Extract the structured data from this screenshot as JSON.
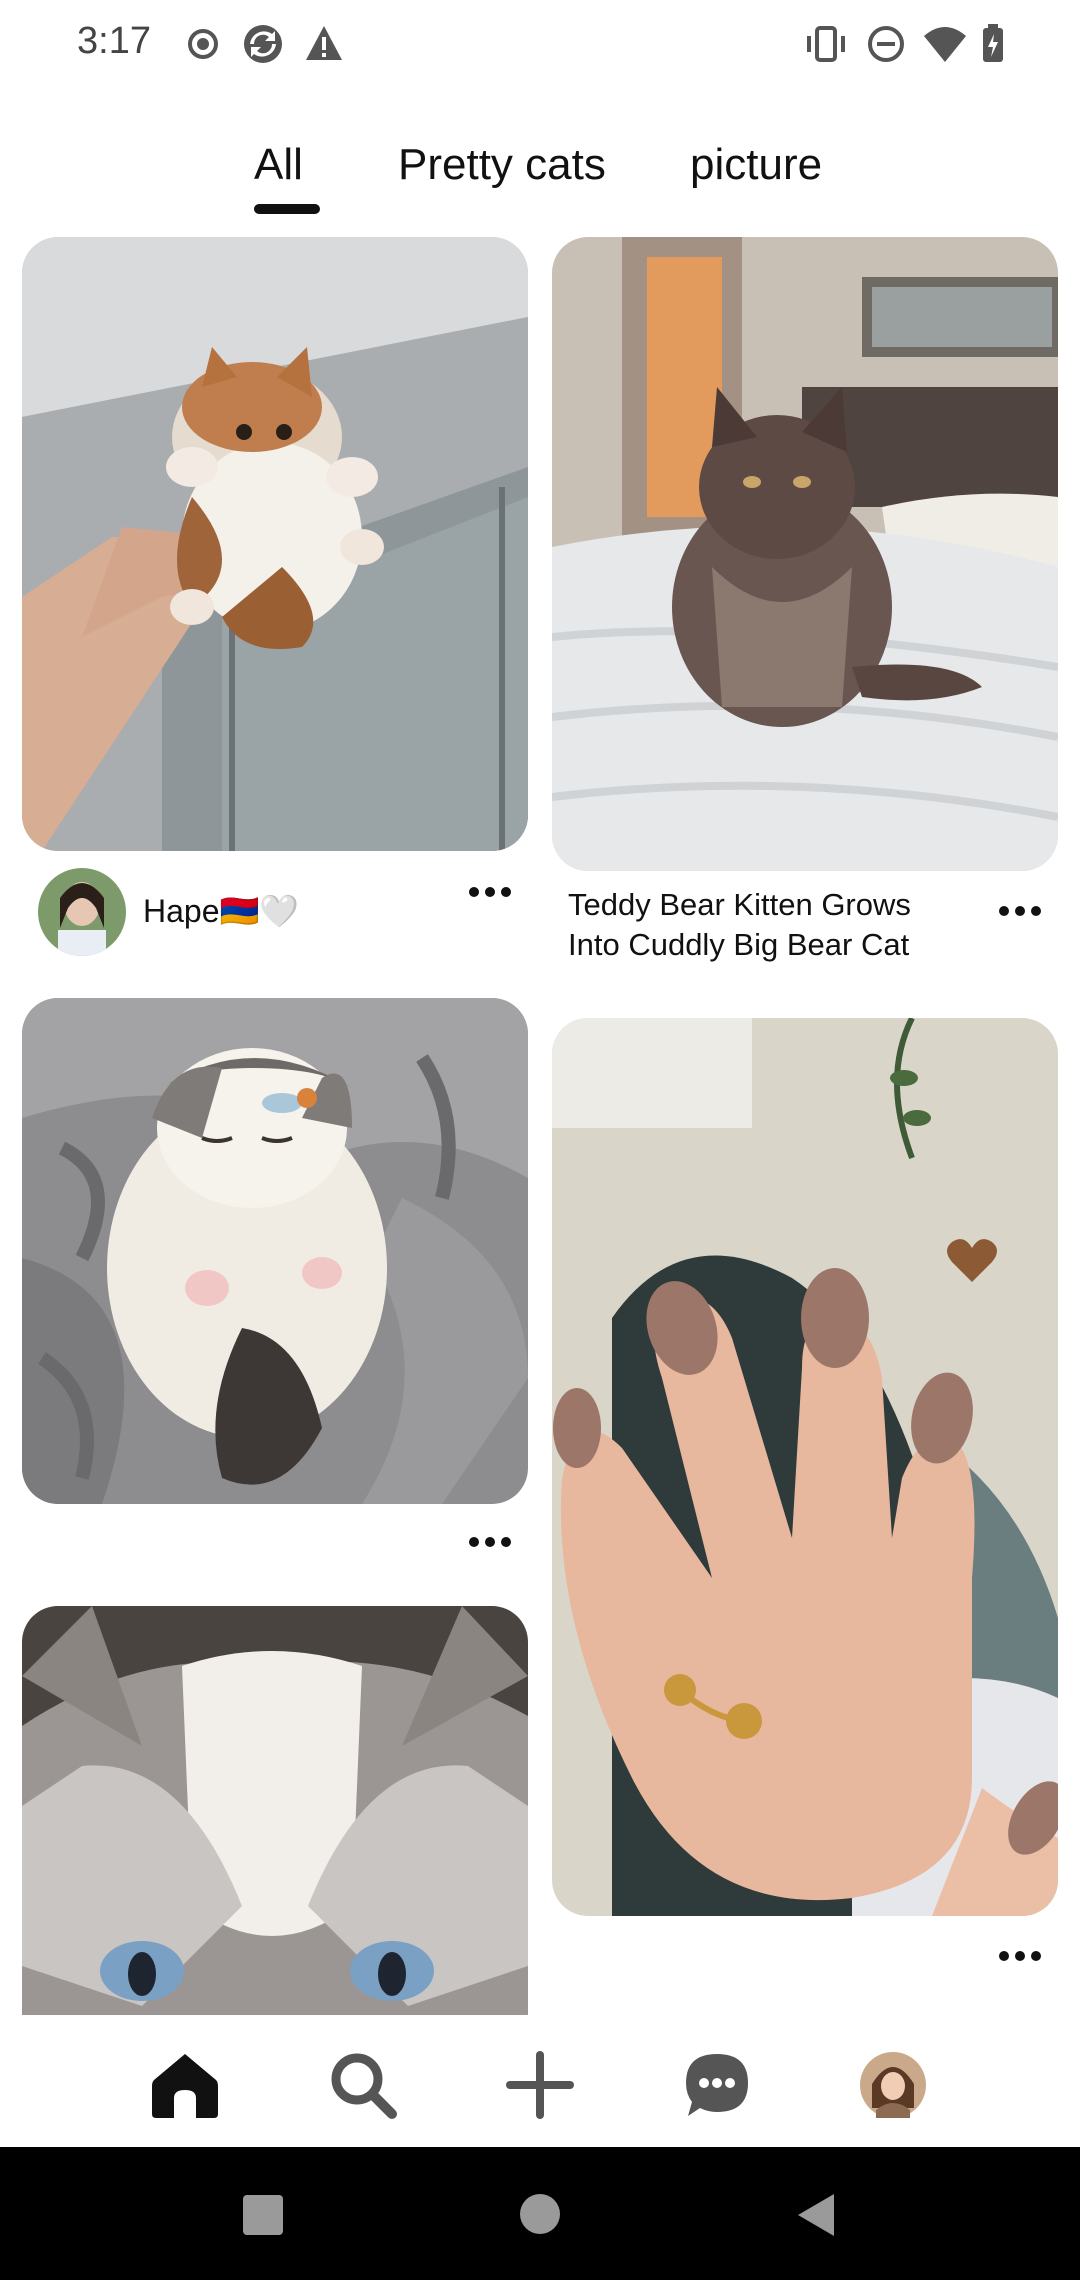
{
  "status_bar": {
    "time": "3:17"
  },
  "tabs": [
    {
      "label": "All",
      "selected": true
    },
    {
      "label": "Pretty cats",
      "selected": false
    },
    {
      "label": "picture",
      "selected": false
    }
  ],
  "pins": [
    {
      "image": "kitten held in hand",
      "author": "Hape🇦🇲🤍"
    },
    {
      "image": "fluffy brown kitten on bed",
      "title_line1": "Teddy Bear Kitten Grows",
      "title_line2": "Into Cuddly Big Bear Cat"
    },
    {
      "image": "white fluffy kitten sleeping on blanket"
    },
    {
      "image": "hand with taupe manicure and gold ring"
    },
    {
      "image": "close-up of ragdoll cat face"
    }
  ],
  "bottom_nav": [
    "home-icon",
    "search-icon",
    "create-icon",
    "messages-icon",
    "profile-avatar"
  ],
  "system_nav": [
    "recents-button",
    "home-button",
    "back-button"
  ]
}
